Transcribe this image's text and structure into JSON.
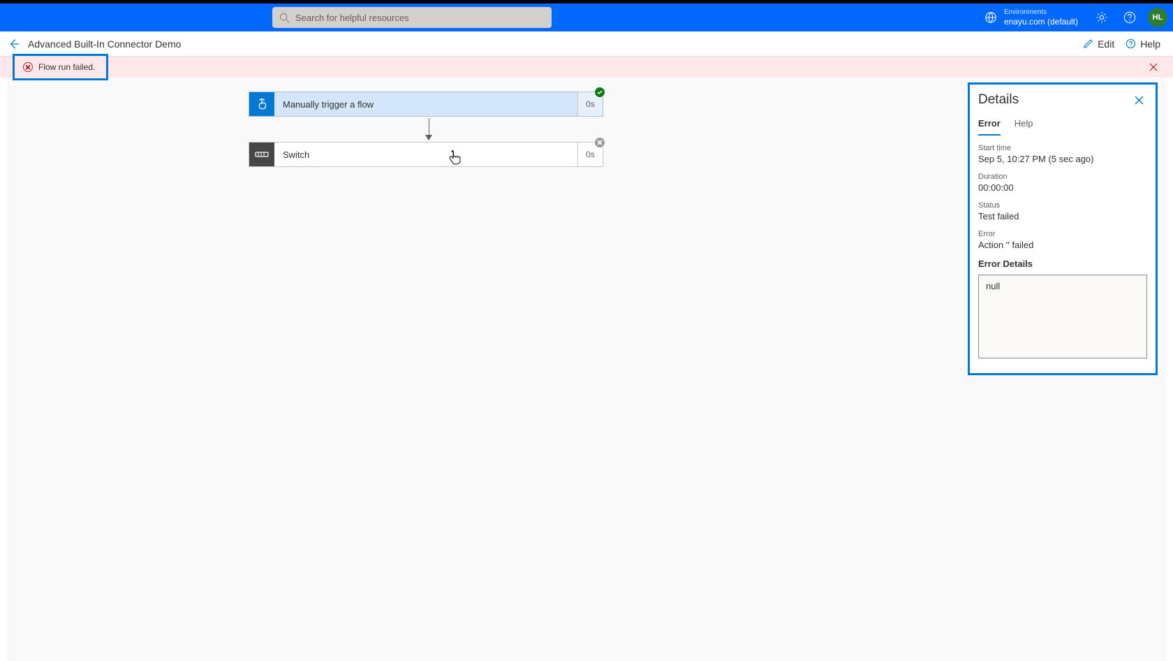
{
  "topBar": {
    "searchPlaceholder": "Search for helpful resources",
    "environmentsLabel": "Environments",
    "environmentName": "enayu.com (default)",
    "avatarInitials": "HL"
  },
  "pageHeader": {
    "title": "Advanced Built-In Connector Demo",
    "editLabel": "Edit",
    "helpLabel": "Help"
  },
  "banner": {
    "message": "Flow run failed."
  },
  "flow": {
    "trigger": {
      "title": "Manually trigger a flow",
      "time": "0s"
    },
    "switch": {
      "title": "Switch",
      "time": "0s"
    }
  },
  "details": {
    "title": "Details",
    "tabs": {
      "error": "Error",
      "help": "Help"
    },
    "startTimeLabel": "Start time",
    "startTime": "Sep 5, 10:27 PM (5 sec ago)",
    "durationLabel": "Duration",
    "duration": "00:00:00",
    "statusLabel": "Status",
    "status": "Test failed",
    "errorLabel": "Error",
    "error": "Action '' failed",
    "errorDetailsLabel": "Error Details",
    "errorDetailsValue": "null"
  }
}
